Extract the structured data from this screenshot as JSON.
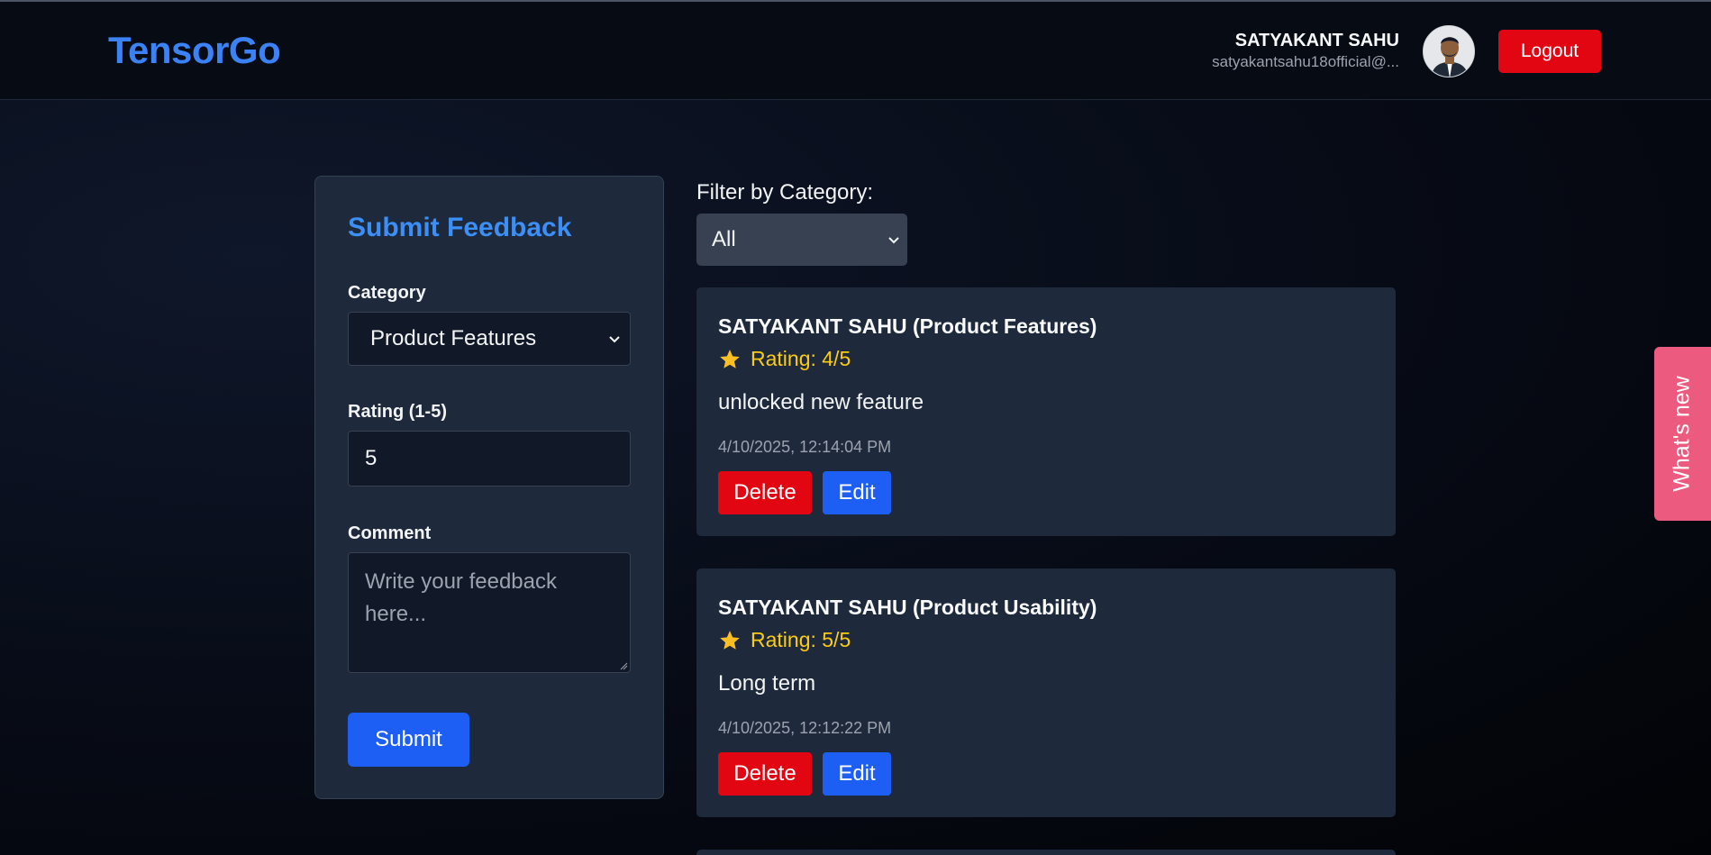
{
  "header": {
    "logo": "TensorGo",
    "user_name": "SATYAKANT SAHU",
    "user_email": "satyakantsahu18official@...",
    "logout_label": "Logout"
  },
  "form": {
    "title": "Submit Feedback",
    "category_label": "Category",
    "category_value": "Product Features",
    "rating_label": "Rating (1-5)",
    "rating_value": "5",
    "comment_label": "Comment",
    "comment_placeholder": "Write your feedback here...",
    "submit_label": "Submit"
  },
  "filter": {
    "label": "Filter by Category:",
    "value": "All"
  },
  "feedback": [
    {
      "title": "SATYAKANT SAHU (Product Features)",
      "rating": "Rating: 4/5",
      "comment": "unlocked new feature",
      "timestamp": "4/10/2025, 12:14:04 PM",
      "delete_label": "Delete",
      "edit_label": "Edit"
    },
    {
      "title": "SATYAKANT SAHU (Product Usability)",
      "rating": "Rating: 5/5",
      "comment": "Long term",
      "timestamp": "4/10/2025, 12:12:22 PM",
      "delete_label": "Delete",
      "edit_label": "Edit"
    }
  ],
  "whats_new": "What's new",
  "colors": {
    "brand": "#3b82f6",
    "danger": "#e10612",
    "primary": "#1d5ef5",
    "star": "#facc15",
    "whats_new": "#ec5b7f"
  },
  "icons": {
    "star": "star-icon",
    "chevron": "chevron-down-icon",
    "avatar": "avatar"
  }
}
